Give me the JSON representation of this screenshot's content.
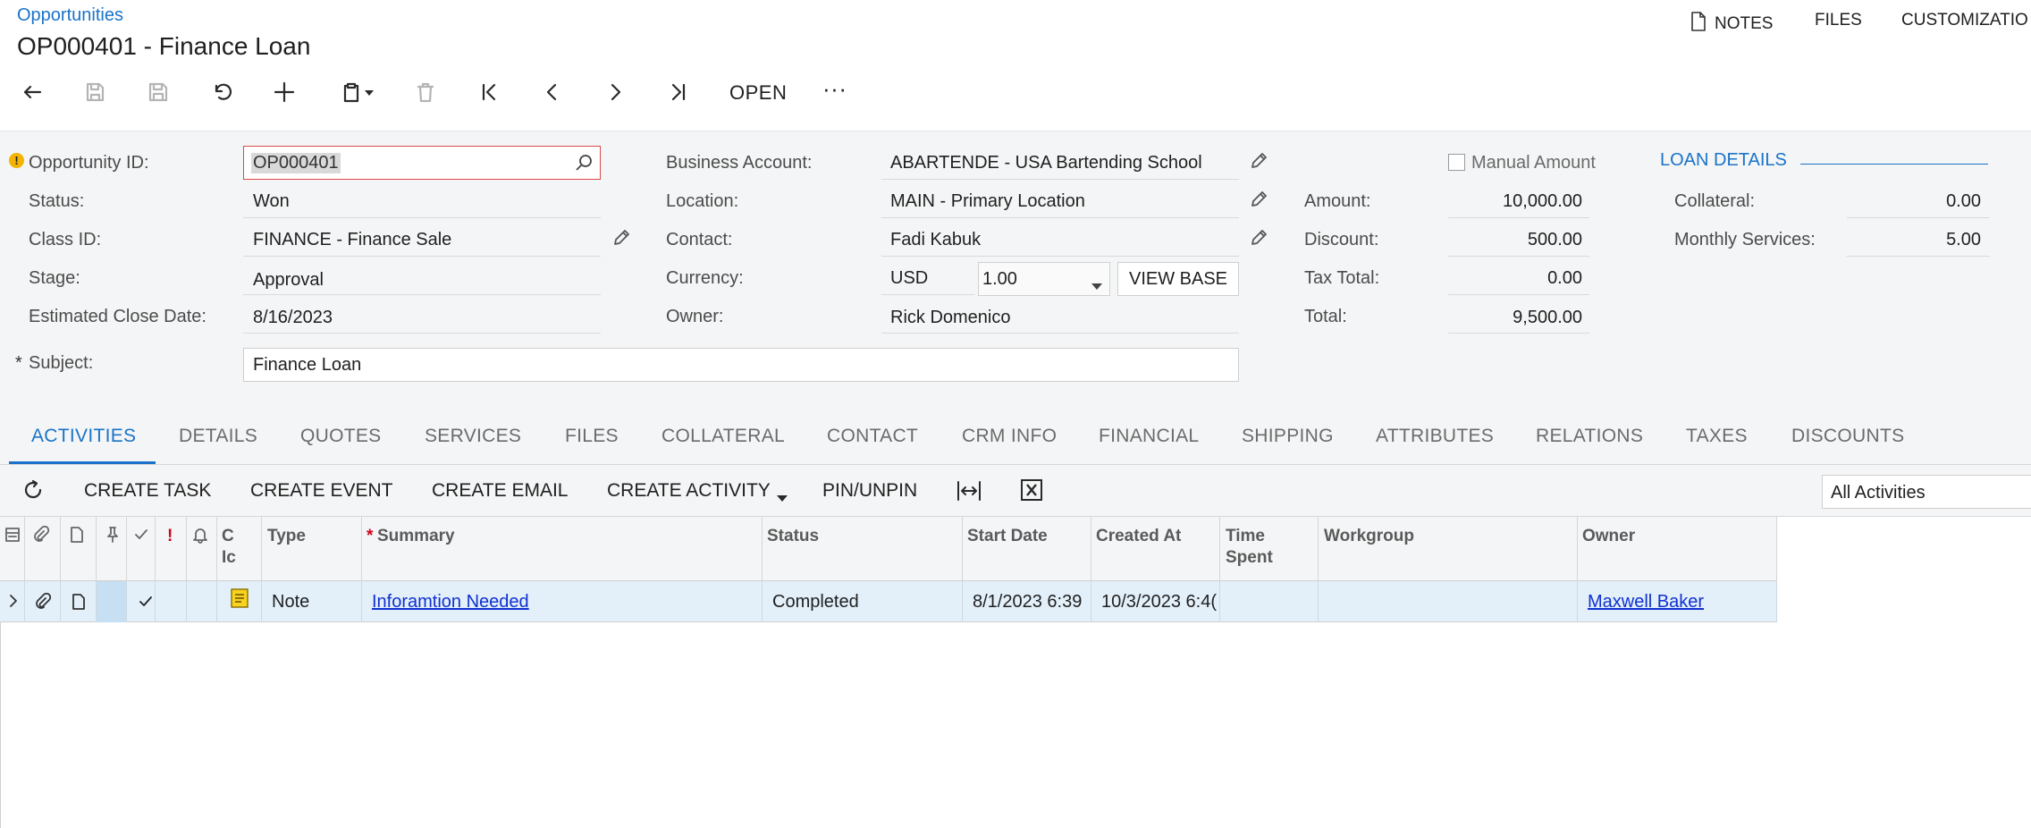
{
  "breadcrumb": "Opportunities",
  "title": "OP000401 - Finance Loan",
  "header_actions": {
    "notes": "NOTES",
    "files": "FILES",
    "customization": "CUSTOMIZATIO"
  },
  "toolbar": {
    "open": "OPEN",
    "more": "···"
  },
  "form": {
    "opportunity_id_label": "Opportunity ID:",
    "opportunity_id": "OP000401",
    "status_label": "Status:",
    "status": "Won",
    "class_id_label": "Class ID:",
    "class_id": "FINANCE - Finance Sale",
    "stage_label": "Stage:",
    "stage": "Approval",
    "close_date_label": "Estimated Close Date:",
    "close_date": "8/16/2023",
    "subject_required": "*",
    "subject_label": "Subject:",
    "subject": "Finance Loan",
    "business_account_label": "Business Account:",
    "business_account": "ABARTENDE - USA Bartending School",
    "location_label": "Location:",
    "location": "MAIN - Primary Location",
    "contact_label": "Contact:",
    "contact": "Fadi Kabuk",
    "currency_label": "Currency:",
    "currency": "USD",
    "rate": "1.00",
    "view_base": "VIEW BASE",
    "owner_label": "Owner:",
    "owner": "Rick Domenico",
    "manual_amount_label": "Manual Amount",
    "amount_label": "Amount:",
    "amount": "10,000.00",
    "discount_label": "Discount:",
    "discount": "500.00",
    "tax_total_label": "Tax Total:",
    "tax_total": "0.00",
    "total_label": "Total:",
    "total": "9,500.00",
    "loan_details": "LOAN DETAILS",
    "collateral_label": "Collateral:",
    "collateral": "0.00",
    "monthly_services_label": "Monthly Services:",
    "monthly_services": "5.00"
  },
  "tabs": [
    "ACTIVITIES",
    "DETAILS",
    "QUOTES",
    "SERVICES",
    "FILES",
    "COLLATERAL",
    "CONTACT",
    "CRM INFO",
    "FINANCIAL",
    "SHIPPING",
    "ATTRIBUTES",
    "RELATIONS",
    "TAXES",
    "DISCOUNTS"
  ],
  "grid_toolbar": {
    "create_task": "CREATE TASK",
    "create_event": "CREATE EVENT",
    "create_email": "CREATE EMAIL",
    "create_activity": "CREATE ACTIVITY",
    "pin_unpin": "PIN/UNPIN",
    "filter": "All Activities"
  },
  "grid": {
    "headers": {
      "priority": "!",
      "class_icon_1": "C",
      "class_icon_2": "Ic",
      "type": "Type",
      "summary_required": "*",
      "summary": "Summary",
      "status": "Status",
      "start_date": "Start Date",
      "created_at": "Created At",
      "time_spent_1": "Time",
      "time_spent_2": "Spent",
      "workgroup": "Workgroup",
      "owner": "Owner"
    },
    "rows": [
      {
        "type": "Note",
        "summary": "Inforamtion Needed",
        "status": "Completed",
        "start_date": "8/1/2023 6:39",
        "created_at": "10/3/2023 6:4(",
        "time_spent": "",
        "workgroup": "",
        "owner": "Maxwell Baker"
      }
    ]
  },
  "colors": {
    "accent": "#1a73c8",
    "link": "#1030d0",
    "error": "#d94b4b",
    "row_highlight": "#e3f0fa"
  }
}
